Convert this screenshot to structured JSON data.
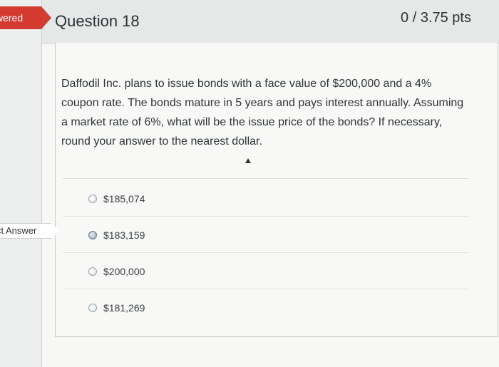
{
  "status_flag": "wered",
  "question": {
    "title": "Question 18",
    "points": "0 / 3.75 pts",
    "text": "Daffodil Inc. plans to issue bonds with a face value of $200,000 and a 4% coupon rate. The bonds mature in 5 years and pays interest annually. Assuming a market rate of 6%, what will be the issue price of the bonds? If necessary, round your answer to the nearest dollar."
  },
  "correct_flag": "ct Answer",
  "options": [
    {
      "label": "$185,074",
      "selected": false
    },
    {
      "label": "$183,159",
      "selected": false,
      "marked_correct": true
    },
    {
      "label": "$200,000",
      "selected": false
    },
    {
      "label": "$181,269",
      "selected": false
    }
  ],
  "colors": {
    "accent_red": "#d43a30",
    "text": "#2e3438"
  }
}
